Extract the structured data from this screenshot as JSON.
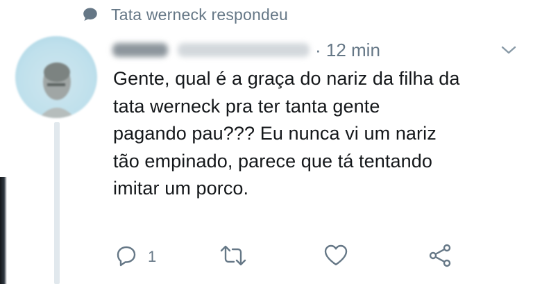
{
  "context": {
    "text": "Tata werneck respondeu",
    "icon": "speech-bubble-icon"
  },
  "tweet": {
    "time": "· 12 min",
    "text": "Gente, qual é a graça do nariz da filha da\ntata werneck pra ter tanta gente\npagando pau??? Eu nunca vi um nariz\ntão empinado, parece que tá tentando\nimitar um porco."
  },
  "actions": {
    "reply_count": "1",
    "icons": [
      "reply-icon",
      "retweet-icon",
      "like-icon",
      "share-icon"
    ]
  },
  "colors": {
    "secondary": "#657786",
    "text": "#14171a",
    "thread": "#e1e8ed"
  }
}
